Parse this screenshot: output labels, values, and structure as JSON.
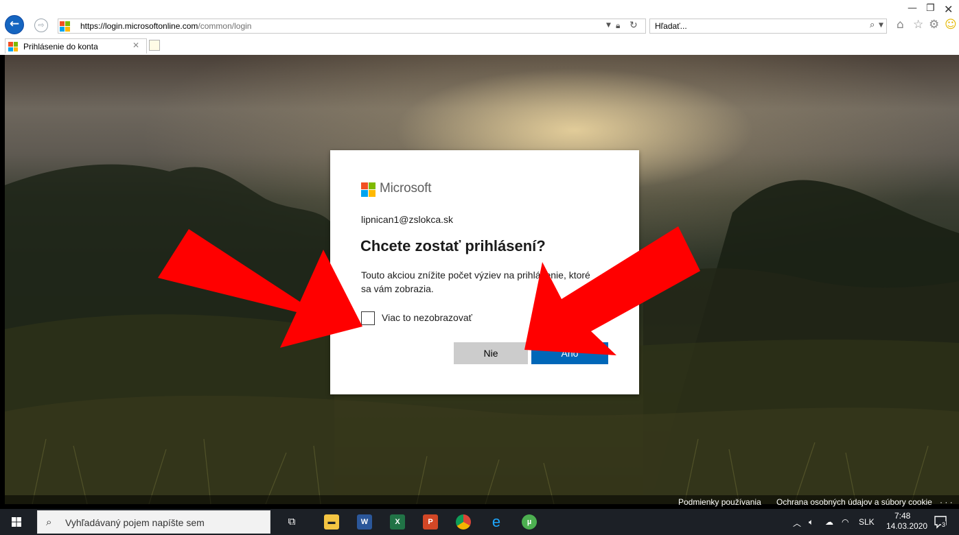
{
  "browser": {
    "url_domain": "https://login.microsoftonline.com",
    "url_path": "/common/login",
    "search_placeholder": "Hľadať...",
    "tab_title": "Prihlásenie do konta"
  },
  "dialog": {
    "brand": "Microsoft",
    "user_email": "lipnican1@zslokca.sk",
    "title": "Chcete zostať prihlásení?",
    "description": "Touto akciou znížite počet výziev na prihlásenie, ktoré sa vám zobrazia.",
    "checkbox_label": "Viac to nezobrazovať",
    "checkbox_checked": false,
    "no_button": "Nie",
    "yes_button": "Áno"
  },
  "footer": {
    "terms": "Podmienky používania",
    "privacy": "Ochrana osobných údajov a súbory cookie",
    "more": "· · ·"
  },
  "taskbar": {
    "search_placeholder": "Vyhľadávaný pojem napíšte sem",
    "apps": [
      "task-view",
      "file-explorer",
      "word",
      "excel",
      "powerpoint",
      "chrome",
      "internet-explorer",
      "utorrent"
    ],
    "language": "SLK",
    "time": "7:48",
    "date": "14.03.2020",
    "notification_count": "3"
  },
  "colors": {
    "microsoft_blue": "#0067b8",
    "ie_blue": "#1565c0",
    "arrow_red": "#ff0000",
    "taskbar": "#1c2026"
  }
}
